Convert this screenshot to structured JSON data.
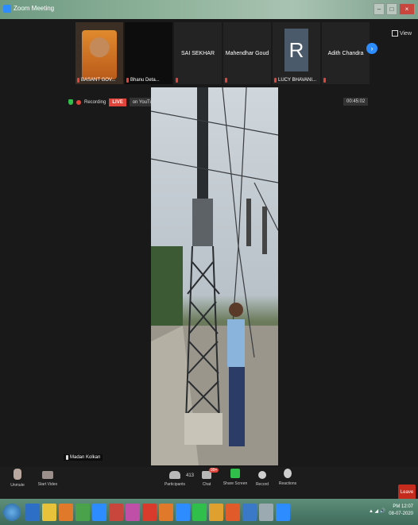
{
  "window": {
    "title": "Zoom Meeting",
    "buttons": [
      "–",
      "□",
      "×"
    ]
  },
  "view_button": {
    "label": "View",
    "icon": "grid-icon"
  },
  "participants": [
    {
      "name": "BASANT GOV...",
      "type": "photo",
      "muted": true
    },
    {
      "name": "Bhanu Deta...",
      "type": "dark",
      "muted": true
    },
    {
      "name": "SAI SEKHAR",
      "type": "name-only",
      "muted": true
    },
    {
      "name": "Mahendhar Goud",
      "type": "name-only",
      "muted": true
    },
    {
      "name": "LUCY BHAVANI...",
      "type": "initial",
      "initial": "R",
      "muted": true
    },
    {
      "name": "Adith Chandra",
      "type": "name-only",
      "muted": true
    }
  ],
  "next_page": "›",
  "status": {
    "recording": "Recording",
    "live": "LIVE",
    "youtube": "on YouTube ▾",
    "timer": "00:45:02"
  },
  "speaker": {
    "name": "Madan Kolkan"
  },
  "controls": {
    "unmute": "Unmute",
    "start_video": "Start Video",
    "participants": "Participants",
    "participant_count": "413",
    "chat": "Chat",
    "chat_badge": "99+",
    "share": "Share Screen",
    "record": "Record",
    "reactions": "Reactions",
    "leave": "Leave"
  },
  "taskbar": {
    "clock_time": "PM 12:07",
    "clock_date": "08-07-2020",
    "icon_colors": [
      "#2d6fc7",
      "#e8c23a",
      "#e07a2a",
      "#4aa34a",
      "#2d8cff",
      "#c9463d",
      "#c04fa8",
      "#d83b2b",
      "#e07a2a",
      "#2d8cff",
      "#2fbf4a",
      "#e0a030",
      "#e05a2a",
      "#3a78c8",
      "#9aaab0",
      "#2d8cff"
    ]
  }
}
